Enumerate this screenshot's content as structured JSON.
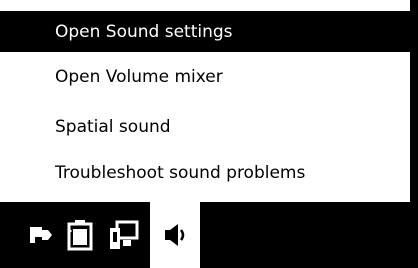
{
  "context_menu": {
    "items": [
      {
        "label": "Open Sound settings",
        "highlighted": true
      },
      {
        "label": "Open Volume mixer",
        "highlighted": false
      },
      {
        "label": "Spatial sound",
        "highlighted": false
      },
      {
        "label": "Troubleshoot sound problems",
        "highlighted": false
      }
    ]
  },
  "taskbar": {
    "tray_icons": [
      {
        "icon": "hidden-icons-flag-icon"
      },
      {
        "icon": "battery-icon"
      },
      {
        "icon": "network-icon"
      },
      {
        "icon": "speaker-icon",
        "active": true
      }
    ]
  },
  "colors": {
    "background": "#ffffff",
    "highlight": "#000000",
    "text": "#000000",
    "highlight_text": "#ffffff",
    "taskbar": "#000000"
  }
}
